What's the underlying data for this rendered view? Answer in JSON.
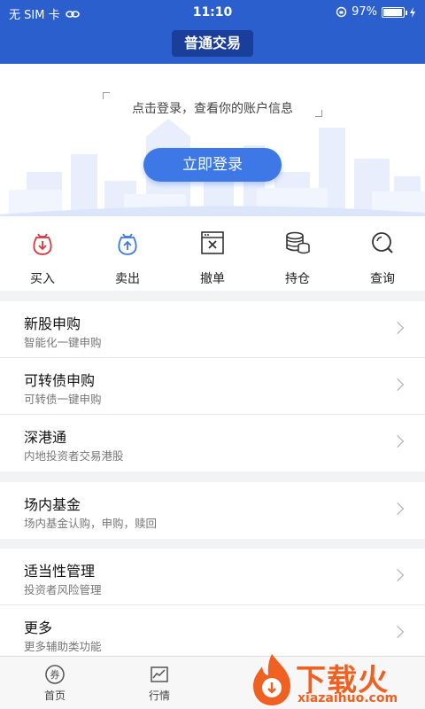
{
  "status_bar": {
    "carrier": "无 SIM 卡",
    "time": "11:10",
    "battery": "97%",
    "battery_level": 0.97
  },
  "nav": {
    "title": "普通交易"
  },
  "hero": {
    "hint": "点击登录，查看你的账户信息",
    "login_button": "立即登录"
  },
  "actions": [
    {
      "label": "买入",
      "icon": "buy-icon"
    },
    {
      "label": "卖出",
      "icon": "sell-icon"
    },
    {
      "label": "撤单",
      "icon": "cancel-order-icon"
    },
    {
      "label": "持仓",
      "icon": "holdings-icon"
    },
    {
      "label": "查询",
      "icon": "search-icon"
    }
  ],
  "menu": [
    {
      "title": "新股申购",
      "subtitle": "智能化一键申购"
    },
    {
      "title": "可转债申购",
      "subtitle": "可转债一键申购"
    },
    {
      "title": "深港通",
      "subtitle": "内地投资者交易港股"
    },
    {
      "title": "场内基金",
      "subtitle": "场内基金认购，申购，赎回"
    },
    {
      "title": "适当性管理",
      "subtitle": "投资者风险管理"
    },
    {
      "title": "更多",
      "subtitle": "更多辅助类功能"
    }
  ],
  "tabs": [
    {
      "label": "首页",
      "icon": "home-icon"
    },
    {
      "label": "行情",
      "icon": "market-chart-icon"
    }
  ],
  "watermark": {
    "text": "下载火",
    "sub": "xiazaihuo.com"
  },
  "colors": {
    "primary": "#2b5fce",
    "button": "#3d78e6",
    "buy": "#d9363e",
    "sell": "#3d78e6",
    "watermark": "#f06020"
  }
}
